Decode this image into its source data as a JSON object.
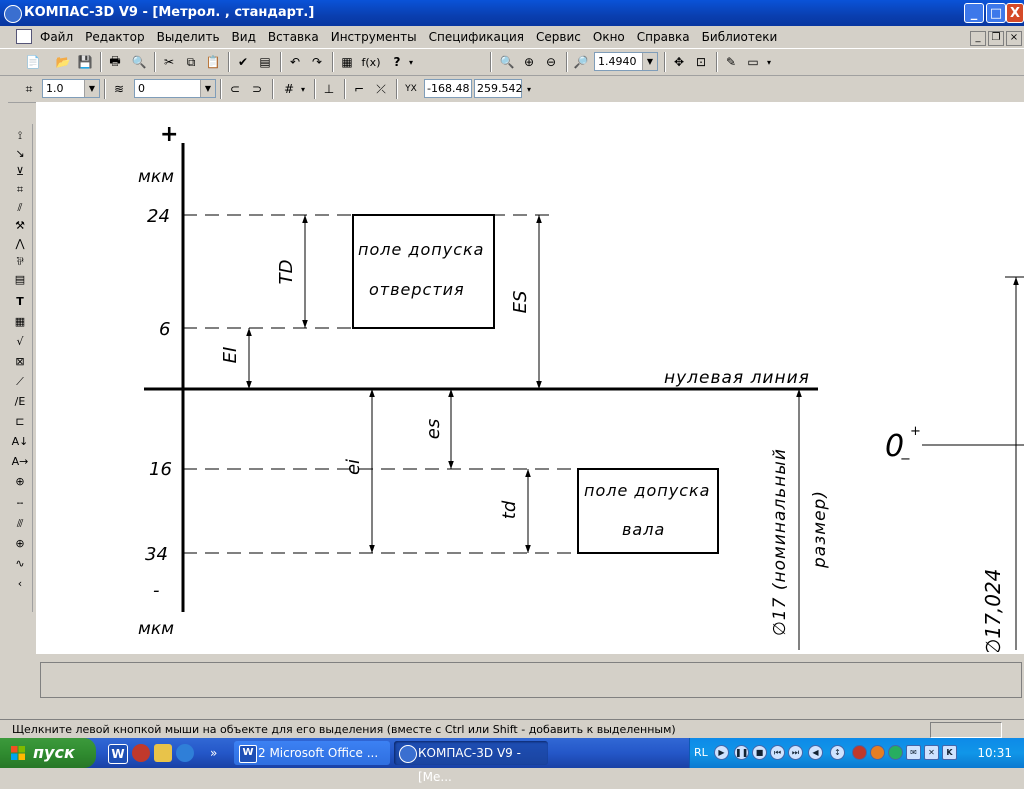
{
  "window": {
    "title": "КОМПАС-3D V9 - [Метрол. , стандарт.]",
    "controls": {
      "minimize": "_",
      "maximize": "□",
      "close": "X"
    }
  },
  "menubar": {
    "items": [
      "Файл",
      "Редактор",
      "Выделить",
      "Вид",
      "Вставка",
      "Инструменты",
      "Спецификация",
      "Сервис",
      "Окно",
      "Справка",
      "Библиотеки"
    ]
  },
  "toolbar_standard": {
    "fx_label": "f(x)",
    "help_label": "?",
    "zoom_value": "1.4940"
  },
  "toolbar_current_state": {
    "step_value": "1.0",
    "layer_value": "0",
    "x_coord": "-168.48",
    "y_coord": "259.542"
  },
  "drawing": {
    "plus_sign": "+",
    "minus_sign": "-",
    "unit_top": "мкм",
    "unit_bottom": "мкм",
    "tick_24": "24",
    "tick_6": "6",
    "tick_16": "16",
    "tick_34": "34",
    "hole_field_line1": "поле допуска",
    "hole_field_line2": "отверстия",
    "shaft_field_line1": "поле допуска",
    "shaft_field_line2": "вала",
    "label_TD": "TD",
    "label_ES": "ES",
    "label_EI": "EI",
    "label_es": "es",
    "label_ei": "ei",
    "label_td": "td",
    "zero_line": "нулевая линия",
    "nominal_line1": "∅17 (номинальный",
    "nominal_line2": "размер)",
    "zero_mark": "0",
    "zero_plus": "+",
    "zero_minus": "−",
    "right_dim": "∅17,024"
  },
  "status": {
    "message": "Щелкните левой кнопкой мыши на объекте для его выделения (вместе с Ctrl или Shift - добавить к выделенным)"
  },
  "taskbar": {
    "start_label": "пуск",
    "tasks": [
      "2 Microsoft Office ...",
      "КОМПАС-3D V9 - [Ме..."
    ],
    "language": "RL",
    "clock": "10:31"
  }
}
